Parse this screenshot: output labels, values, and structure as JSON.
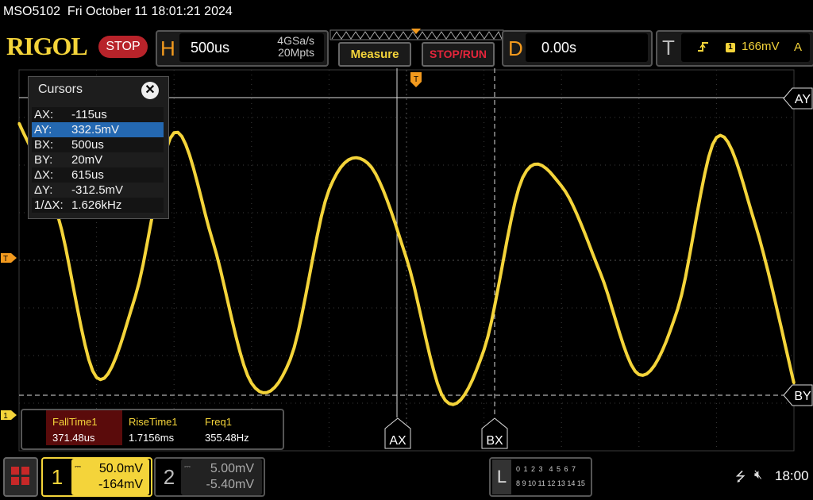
{
  "title_line": "MSO5102  Fri October 11 18:01:21 2024",
  "brand": "RIGOL",
  "run_state": "STOP",
  "horizontal": {
    "letter": "H",
    "timebase": "500us",
    "sample_rate": "4GSa/s",
    "memory_depth": "20Mpts"
  },
  "buttons": {
    "measure": "Measure",
    "stop_run": "STOP/RUN"
  },
  "delay": {
    "letter": "D",
    "value": "0.00s"
  },
  "trigger": {
    "letter": "T",
    "edge_icon": "rising-edge-icon",
    "channel": "1",
    "level": "166mV",
    "mode": "A"
  },
  "markers": {
    "trigger_position": "T",
    "trigger_level": "T",
    "ch1_ground": "1",
    "ay": "AY",
    "by": "BY",
    "ax": "AX",
    "bx": "BX"
  },
  "cursors": {
    "title": "Cursors",
    "rows": [
      {
        "key": "AX:",
        "value": "-115us"
      },
      {
        "key": "AY:",
        "value": "332.5mV"
      },
      {
        "key": "BX:",
        "value": "500us"
      },
      {
        "key": "BY:",
        "value": "20mV"
      },
      {
        "key": "ΔX:",
        "value": "615us"
      },
      {
        "key": "ΔY:",
        "value": "-312.5mV"
      },
      {
        "key": "1/ΔX:",
        "value": "1.626kHz"
      }
    ],
    "selected_row": 1
  },
  "measurements": [
    {
      "name": "FallTime1",
      "value": "371.48us"
    },
    {
      "name": "RiseTime1",
      "value": "1.7156ms"
    },
    {
      "name": "Freq1",
      "value": "355.48Hz"
    }
  ],
  "channel1": {
    "number": "1",
    "scale": "50.0mV",
    "offset": "-164mV",
    "color": "#f4d43a"
  },
  "channel2": {
    "number": "2",
    "scale": "5.00mV",
    "offset": "-5.40mV"
  },
  "logic": {
    "letter": "L",
    "row1": "0 1 2 3  4 5 6 7",
    "row2": "8 9 10 11 12 13 14 15"
  },
  "status": {
    "clock": "18:00"
  },
  "colors": {
    "trace": "#f4d43a",
    "accent": "#f39a1e",
    "stop": "#b8232a",
    "selected": "#2468b1"
  },
  "chart_data": {
    "type": "line",
    "x_unit": "ms",
    "y_unit": "mV",
    "x": [
      -2.5,
      -2.25,
      -2.0,
      -1.75,
      -1.5,
      -1.25,
      -1.0,
      -0.75,
      -0.5,
      -0.25,
      0.0,
      0.25,
      0.5,
      0.75,
      1.0,
      1.25,
      1.5,
      1.75,
      2.0,
      2.25,
      2.5
    ],
    "values": [
      308,
      211,
      41,
      126,
      298,
      184,
      35,
      60,
      238,
      266,
      166,
      17,
      70,
      251,
      242,
      151,
      44,
      113,
      293,
      202,
      35
    ],
    "xlim": [
      -2.5,
      2.5
    ],
    "ylim": [
      -36,
      364
    ],
    "grid": true
  }
}
